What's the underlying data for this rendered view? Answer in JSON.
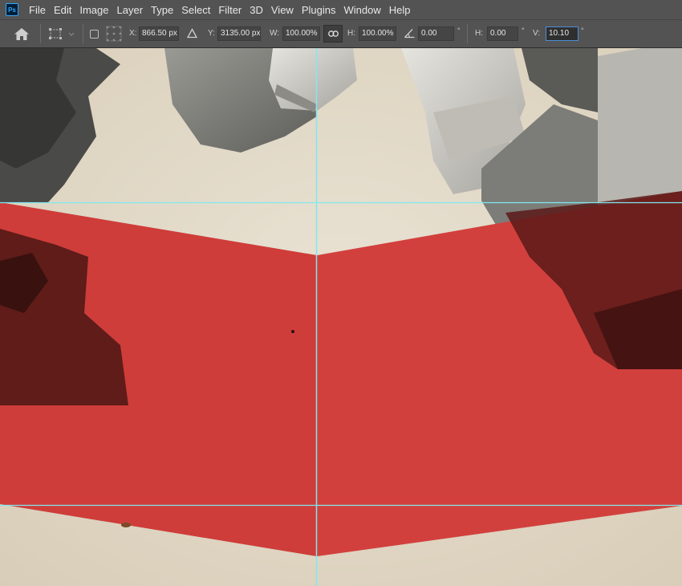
{
  "app": {
    "logo": "Ps"
  },
  "menu": [
    "File",
    "Edit",
    "Image",
    "Layer",
    "Type",
    "Select",
    "Filter",
    "3D",
    "View",
    "Plugins",
    "Window",
    "Help"
  ],
  "options": {
    "x_label": "X:",
    "x_value": "866.50 px",
    "y_label": "Y:",
    "y_value": "3135.00 px",
    "w_label": "W:",
    "w_value": "100.00%",
    "h_label": "H:",
    "h_value": "100.00%",
    "angle_value": "0.00",
    "hskew_label": "H:",
    "hskew_value": "0.00",
    "vskew_label": "V:",
    "vskew_value": "10.10",
    "degree_symbol": "°"
  },
  "icons": {
    "home": "home-icon",
    "transform": "transform-selection-icon",
    "reference_point": "reference-point-icon",
    "delta": "delta-icon",
    "link": "link-icon",
    "angle": "angle-icon"
  },
  "colors": {
    "banner_red": "#d2403d",
    "guide_cyan": "#7fe9f0",
    "paper": "#e4dccd",
    "ui_panel": "#535353"
  }
}
